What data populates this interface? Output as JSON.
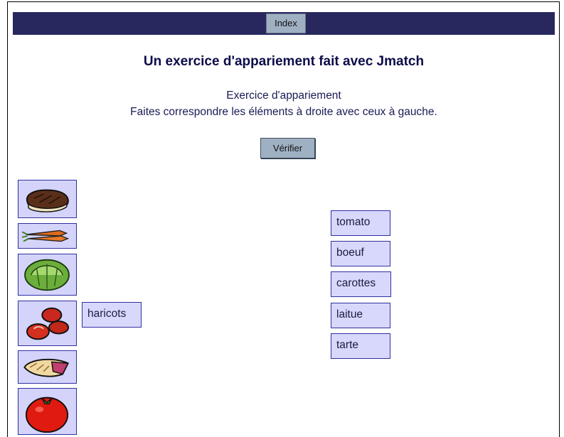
{
  "nav": {
    "index_label": "Index"
  },
  "header": {
    "title": "Un exercice d'appariement fait avec Jmatch",
    "subtitle": "Exercice d'appariement",
    "instructions": "Faites correspondre les éléments à droite avec ceux à gauche."
  },
  "actions": {
    "check_label": "Vérifier"
  },
  "images": [
    {
      "icon": "steak-icon"
    },
    {
      "icon": "carrots-icon"
    },
    {
      "icon": "lettuce-icon"
    },
    {
      "icon": "beans-icon"
    },
    {
      "icon": "pie-icon"
    },
    {
      "icon": "tomato-icon"
    }
  ],
  "placed": {
    "beans": "haricots"
  },
  "words": [
    "tomato",
    "boeuf",
    "carottes",
    "laitue",
    "tarte"
  ],
  "colors": {
    "navbar": "#28285e",
    "button": "#9fb0c3",
    "tile_bg": "#d8d8fc",
    "tile_border": "#3030a0",
    "title_text": "#0c0c4a"
  }
}
